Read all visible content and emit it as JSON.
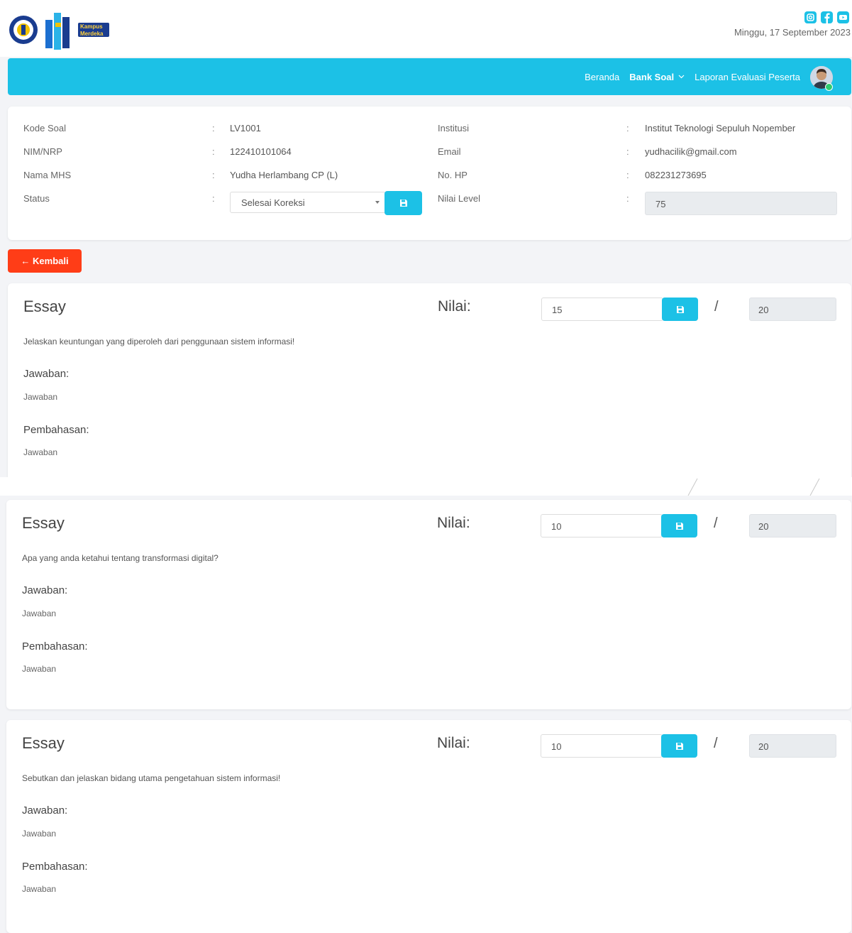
{
  "header": {
    "logo_text": "Kampus Merdeka",
    "date": "Minggu, 17 September 2023",
    "social_icons": [
      "instagram-icon",
      "facebook-icon",
      "youtube-icon"
    ]
  },
  "nav": {
    "beranda": "Beranda",
    "bank_soal": "Bank Soal",
    "laporan": "Laporan Evaluasi Peserta"
  },
  "info": {
    "kode_soal_label": "Kode Soal",
    "kode_soal": "LV1001",
    "nim_label": "NIM/NRP",
    "nim": "122410101064",
    "nama_label": "Nama MHS",
    "nama": "Yudha Herlambang CP (L)",
    "status_label": "Status",
    "status": "Selesai Koreksi",
    "institusi_label": "Institusi",
    "institusi": "Institut Teknologi Sepuluh Nopember",
    "email_label": "Email",
    "email": "yudhacilik@gmail.com",
    "hp_label": "No. HP",
    "hp": "082231273695",
    "nilai_level_label": "Nilai Level",
    "nilai_level": "75",
    "colon": ":"
  },
  "back_label": "← Kembali",
  "essays": [
    {
      "title": "Essay",
      "nilai_label": "Nilai:",
      "nilai": "15",
      "slash": "/",
      "max": "20",
      "question": "Jelaskan keuntungan yang diperoleh dari penggunaan sistem informasi!",
      "jawaban_label": "Jawaban:",
      "jawaban": "Jawaban",
      "pembahasan_label": "Pembahasan:",
      "pembahasan": "Jawaban"
    },
    {
      "title": "Essay",
      "nilai_label": "Nilai:",
      "nilai": "10",
      "slash": "/",
      "max": "20",
      "question": "Apa yang anda ketahui tentang transformasi digital?",
      "jawaban_label": "Jawaban:",
      "jawaban": "Jawaban",
      "pembahasan_label": "Pembahasan:",
      "pembahasan": "Jawaban"
    },
    {
      "title": "Essay",
      "nilai_label": "Nilai:",
      "nilai": "10",
      "slash": "/",
      "max": "20",
      "question": "Sebutkan dan jelaskan bidang utama pengetahuan sistem informasi!",
      "jawaban_label": "Jawaban:",
      "jawaban": "Jawaban",
      "pembahasan_label": "Pembahasan:",
      "pembahasan": "Jawaban"
    }
  ],
  "colors": {
    "primary": "#1cc1e6",
    "danger": "#ff3d17",
    "background": "#f3f4f7"
  }
}
